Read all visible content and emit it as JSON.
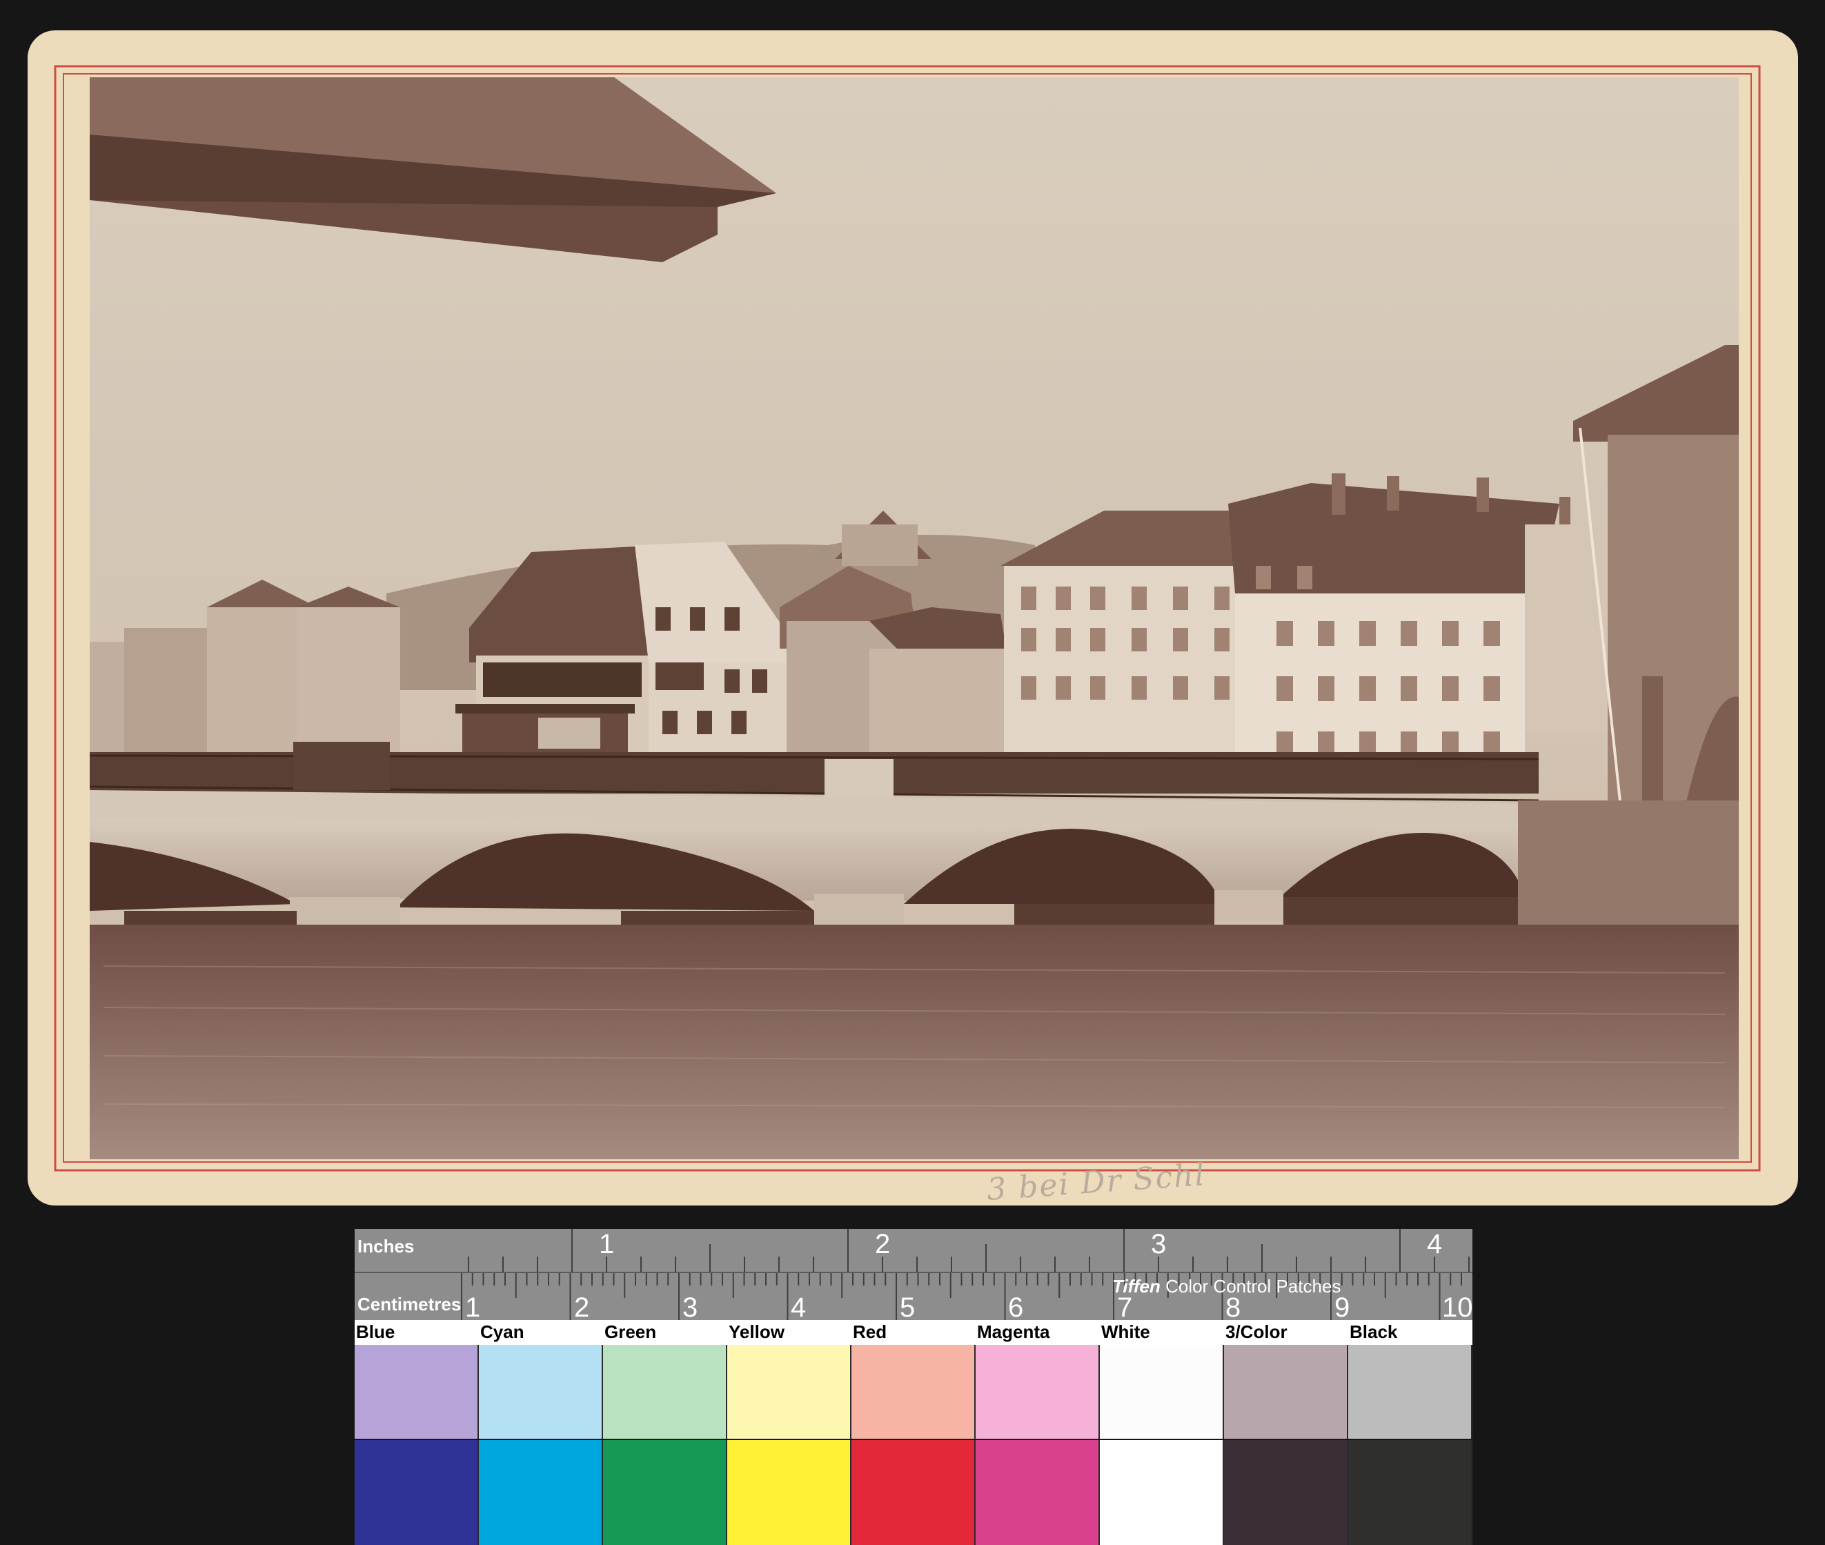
{
  "photo": {
    "handwritten_note": "3 bei Dr Schl"
  },
  "target": {
    "inches_label": "Inches",
    "centimetres_label": "Centimetres",
    "inch_numbers": [
      "1",
      "2",
      "3",
      "4"
    ],
    "cm_numbers": [
      "1",
      "2",
      "3",
      "4",
      "5",
      "6",
      "7",
      "8",
      "9",
      "10"
    ],
    "tiffen_brand": "Tiffen",
    "tiffen_text": "Color Control Patches",
    "patches": [
      {
        "label": "Blue",
        "light": "#b6a4d8",
        "dark": "#2f3395"
      },
      {
        "label": "Cyan",
        "light": "#b4e0f3",
        "dark": "#00a6de"
      },
      {
        "label": "Green",
        "light": "#b8e2c0",
        "dark": "#159a55"
      },
      {
        "label": "Yellow",
        "light": "#fdf7b2",
        "dark": "#fff136"
      },
      {
        "label": "Red",
        "light": "#f7b4a4",
        "dark": "#e3283a"
      },
      {
        "label": "Magenta",
        "light": "#f5b1d8",
        "dark": "#d9408e"
      },
      {
        "label": "White",
        "light": "#fcfcfc",
        "dark": "#ffffff"
      },
      {
        "label": "3/Color",
        "light": "#b7a6ac",
        "dark": "#3a2d36"
      },
      {
        "label": "Black",
        "light": "#bcbcbc",
        "dark": "#2f302e"
      }
    ]
  }
}
